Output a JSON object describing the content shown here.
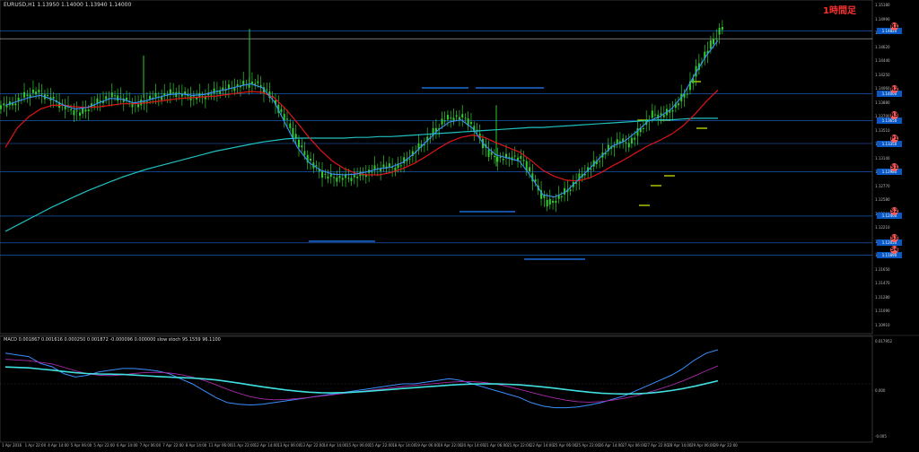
{
  "header": {
    "symbol_info": "EURUSD,H1  1.13950 1.14000 1.13940 1.14000",
    "badge": "1時間足"
  },
  "macd_header": "MACD 0.001867 0.001616 0.000250 0.001872 -0.000096 0.000000 slow stoch 95.1559 96.1100",
  "price_axis": [
    "1.15180",
    "1.14990",
    "1.14810",
    "1.14620",
    "1.14440",
    "1.14250",
    "1.14060",
    "1.13880",
    "1.13700",
    "1.13510",
    "1.13320",
    "1.13140",
    "1.12950",
    "1.12770",
    "1.12580",
    "1.12390",
    "1.12210",
    "1.12020",
    "1.11840",
    "1.11650",
    "1.11470",
    "1.11280",
    "1.11090",
    "1.10910"
  ],
  "right_boxes": [
    "1.14820",
    "1.14000",
    "1.13650",
    "1.13350",
    "1.12980",
    "1.12400",
    "1.12050",
    "1.11890"
  ],
  "macd_axis": [
    "0.017952",
    "0.000",
    "-0.005"
  ],
  "circle_labels": [
    "R1",
    "R2",
    "R3",
    "P1",
    "S1",
    "S2",
    "S3",
    "S4"
  ],
  "colors": {
    "candle": "#2ecc2e",
    "ma_fast": "#3a8fff",
    "ma_mid": "#e01515",
    "ma_slow": "#20c0c0",
    "level_line": "#1e6ad8",
    "signal": "#ff3030",
    "macd_line": "#aa2aa8"
  },
  "chart_data": {
    "type": "candlestick",
    "title": "EURUSD,H1",
    "x_labels": [
      "1 Apr 2016",
      "1 Apr 22:00",
      "4 Apr 14:00",
      "5 Apr 06:00",
      "5 Apr 22:00",
      "6 Apr 14:00",
      "7 Apr 06:00",
      "7 Apr 22:00",
      "8 Apr 14:00",
      "11 Apr 06:00",
      "11 Apr 22:00",
      "12 Apr 14:00",
      "13 Apr 06:00",
      "13 Apr 22:00",
      "14 Apr 14:00",
      "15 Apr 06:00",
      "15 Apr 22:00",
      "18 Apr 14:00",
      "19 Apr 06:00",
      "19 Apr 22:00",
      "20 Apr 14:00",
      "21 Apr 06:00",
      "21 Apr 22:00",
      "22 Apr 14:00",
      "25 Apr 06:00",
      "25 Apr 22:00",
      "26 Apr 14:00",
      "27 Apr 06:00",
      "27 Apr 22:00",
      "28 Apr 14:00",
      "29 Apr 06:00",
      "29 Apr 22:00"
    ],
    "close_series": [
      1.1385,
      1.1395,
      1.1403,
      1.1398,
      1.1389,
      1.138,
      1.1374,
      1.1385,
      1.1393,
      1.1398,
      1.139,
      1.1385,
      1.1395,
      1.1397,
      1.1402,
      1.1398,
      1.1395,
      1.1399,
      1.1405,
      1.1408,
      1.1412,
      1.1414,
      1.1403,
      1.138,
      1.1355,
      1.1325,
      1.1305,
      1.1292,
      1.129,
      1.129,
      1.1293,
      1.13,
      1.1305,
      1.1303,
      1.1315,
      1.133,
      1.1345,
      1.1365,
      1.137,
      1.1368,
      1.1348,
      1.132,
      1.1315,
      1.1318,
      1.1312,
      1.128,
      1.1255,
      1.1265,
      1.1278,
      1.1295,
      1.1308,
      1.1325,
      1.1338,
      1.1335,
      1.1355,
      1.1373,
      1.1372,
      1.1385,
      1.1405,
      1.144,
      1.1465,
      1.149
    ],
    "ma_fast": [
      1.1385,
      1.139,
      1.1395,
      1.1398,
      1.1393,
      1.1385,
      1.138,
      1.1382,
      1.1388,
      1.1394,
      1.1393,
      1.1388,
      1.1391,
      1.1395,
      1.1399,
      1.14,
      1.1398,
      1.1399,
      1.1403,
      1.1406,
      1.141,
      1.1413,
      1.1408,
      1.139,
      1.136,
      1.133,
      1.131,
      1.13,
      1.1295,
      1.1294,
      1.1295,
      1.1298,
      1.1302,
      1.1304,
      1.131,
      1.1322,
      1.1337,
      1.1352,
      1.1363,
      1.1366,
      1.1355,
      1.1333,
      1.132,
      1.1316,
      1.1312,
      1.1292,
      1.1268,
      1.1265,
      1.1272,
      1.1287,
      1.1302,
      1.1318,
      1.1332,
      1.1338,
      1.135,
      1.1364,
      1.137,
      1.138,
      1.1398,
      1.1425,
      1.145,
      1.147
    ],
    "ma_mid": [
      1.133,
      1.1355,
      1.137,
      1.138,
      1.1385,
      1.1385,
      1.1383,
      1.1382,
      1.1383,
      1.1385,
      1.1387,
      1.1387,
      1.1388,
      1.139,
      1.1392,
      1.1394,
      1.1395,
      1.1396,
      1.1397,
      1.1399,
      1.1401,
      1.1403,
      1.1402,
      1.1395,
      1.138,
      1.1362,
      1.1343,
      1.1326,
      1.1312,
      1.1302,
      1.1296,
      1.1294,
      1.1294,
      1.1297,
      1.1302,
      1.1309,
      1.1318,
      1.1328,
      1.1337,
      1.1343,
      1.1346,
      1.1343,
      1.1336,
      1.133,
      1.1324,
      1.1313,
      1.13,
      1.1292,
      1.1287,
      1.1286,
      1.129,
      1.1297,
      1.1306,
      1.1314,
      1.1323,
      1.1332,
      1.1339,
      1.1347,
      1.1358,
      1.1373,
      1.139,
      1.1405
    ],
    "ma_slow": [
      1.122,
      1.1228,
      1.1236,
      1.1244,
      1.1252,
      1.1259,
      1.1266,
      1.1273,
      1.1279,
      1.1285,
      1.1291,
      1.1296,
      1.1301,
      1.1305,
      1.1309,
      1.1313,
      1.1317,
      1.1321,
      1.1325,
      1.1328,
      1.1331,
      1.1334,
      1.1337,
      1.1339,
      1.1341,
      1.1342,
      1.1342,
      1.1342,
      1.1342,
      1.1342,
      1.1343,
      1.1343,
      1.1344,
      1.1344,
      1.1345,
      1.1346,
      1.1347,
      1.1348,
      1.1349,
      1.135,
      1.1351,
      1.1352,
      1.1353,
      1.1354,
      1.1355,
      1.1356,
      1.1356,
      1.1357,
      1.1358,
      1.1359,
      1.136,
      1.1361,
      1.1362,
      1.1363,
      1.1364,
      1.1365,
      1.1366,
      1.1366,
      1.1367,
      1.1368,
      1.1368,
      1.1368
    ],
    "macd_main": [
      0.9,
      0.85,
      0.8,
      0.6,
      0.5,
      0.3,
      0.2,
      0.25,
      0.35,
      0.4,
      0.45,
      0.45,
      0.42,
      0.38,
      0.3,
      0.15,
      0.0,
      -0.2,
      -0.4,
      -0.55,
      -0.6,
      -0.62,
      -0.6,
      -0.55,
      -0.5,
      -0.45,
      -0.4,
      -0.35,
      -0.3,
      -0.25,
      -0.2,
      -0.15,
      -0.1,
      -0.05,
      0.0,
      0.0,
      0.05,
      0.1,
      0.15,
      0.1,
      0.0,
      -0.1,
      -0.2,
      -0.3,
      -0.4,
      -0.55,
      -0.65,
      -0.7,
      -0.7,
      -0.68,
      -0.62,
      -0.55,
      -0.45,
      -0.35,
      -0.2,
      -0.05,
      0.1,
      0.25,
      0.45,
      0.7,
      0.9,
      1.0
    ]
  }
}
